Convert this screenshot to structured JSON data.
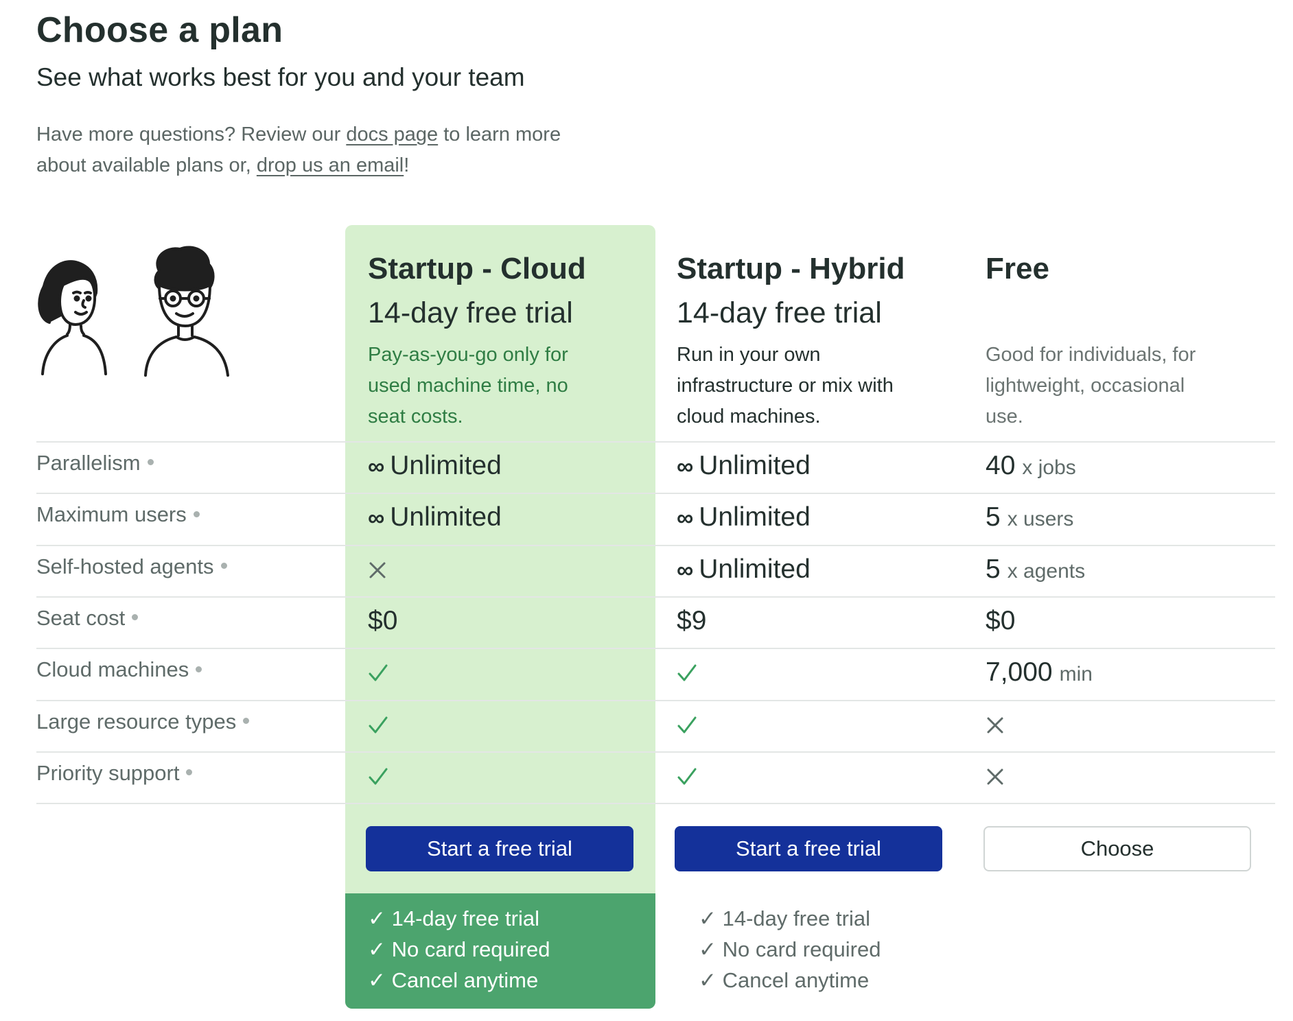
{
  "header": {
    "title": "Choose a plan",
    "subtitle": "See what works best for you and your team",
    "intro_part1": "Have more questions? Review our ",
    "docs_link": "docs page",
    "intro_part2": " to learn more about available plans or, ",
    "email_link": "drop us an email",
    "intro_part3": "!"
  },
  "plans": [
    {
      "name": "Startup - Cloud",
      "trial": "14-day free trial",
      "description": "Pay-as-you-go only for used machine time, no seat costs.",
      "button": "Start a free trial",
      "highlighted": true,
      "perks": [
        "✓ 14-day free trial",
        "✓ No card required",
        "✓ Cancel anytime"
      ]
    },
    {
      "name": "Startup - Hybrid",
      "trial": "14-day free trial",
      "description": "Run in your own infrastructure or mix with cloud machines.",
      "button": "Start a free trial",
      "highlighted": false,
      "perks": [
        "✓ 14-day free trial",
        "✓ No card required",
        "✓ Cancel anytime"
      ]
    },
    {
      "name": "Free",
      "trial": "",
      "description": "Good for individuals, for lightweight, occasional use.",
      "button": "Choose",
      "highlighted": false,
      "perks": []
    }
  ],
  "features": [
    {
      "label": "Parallelism",
      "cloud": {
        "type": "infinite",
        "text": "Unlimited"
      },
      "hybrid": {
        "type": "infinite",
        "text": "Unlimited"
      },
      "free": {
        "type": "value",
        "value": "40",
        "unit": "x jobs"
      }
    },
    {
      "label": "Maximum users",
      "cloud": {
        "type": "infinite",
        "text": "Unlimited"
      },
      "hybrid": {
        "type": "infinite",
        "text": "Unlimited"
      },
      "free": {
        "type": "value",
        "value": "5",
        "unit": "x users"
      }
    },
    {
      "label": "Self-hosted agents",
      "cloud": {
        "type": "cross"
      },
      "hybrid": {
        "type": "infinite",
        "text": "Unlimited"
      },
      "free": {
        "type": "value",
        "value": "5",
        "unit": "x agents"
      }
    },
    {
      "label": "Seat cost",
      "cloud": {
        "type": "value",
        "value": "$0"
      },
      "hybrid": {
        "type": "value",
        "value": "$9"
      },
      "free": {
        "type": "value",
        "value": "$0"
      }
    },
    {
      "label": "Cloud machines",
      "cloud": {
        "type": "check"
      },
      "hybrid": {
        "type": "check"
      },
      "free": {
        "type": "value",
        "value": "7,000",
        "unit": "min"
      }
    },
    {
      "label": "Large resource types",
      "cloud": {
        "type": "check"
      },
      "hybrid": {
        "type": "check"
      },
      "free": {
        "type": "cross"
      }
    },
    {
      "label": "Priority support",
      "cloud": {
        "type": "check"
      },
      "hybrid": {
        "type": "check"
      },
      "free": {
        "type": "cross"
      }
    }
  ],
  "symbols": {
    "infinity": "∞"
  },
  "colors": {
    "highlight_bg": "#d7f0cf",
    "highlight_footer": "#4ca46e",
    "primary_button": "#14319a",
    "check": "#3aa15f",
    "cross": "#5f6b69"
  },
  "icons": {
    "check": "checkmark-icon",
    "cross": "cross-icon",
    "info": "info-dot-icon"
  }
}
